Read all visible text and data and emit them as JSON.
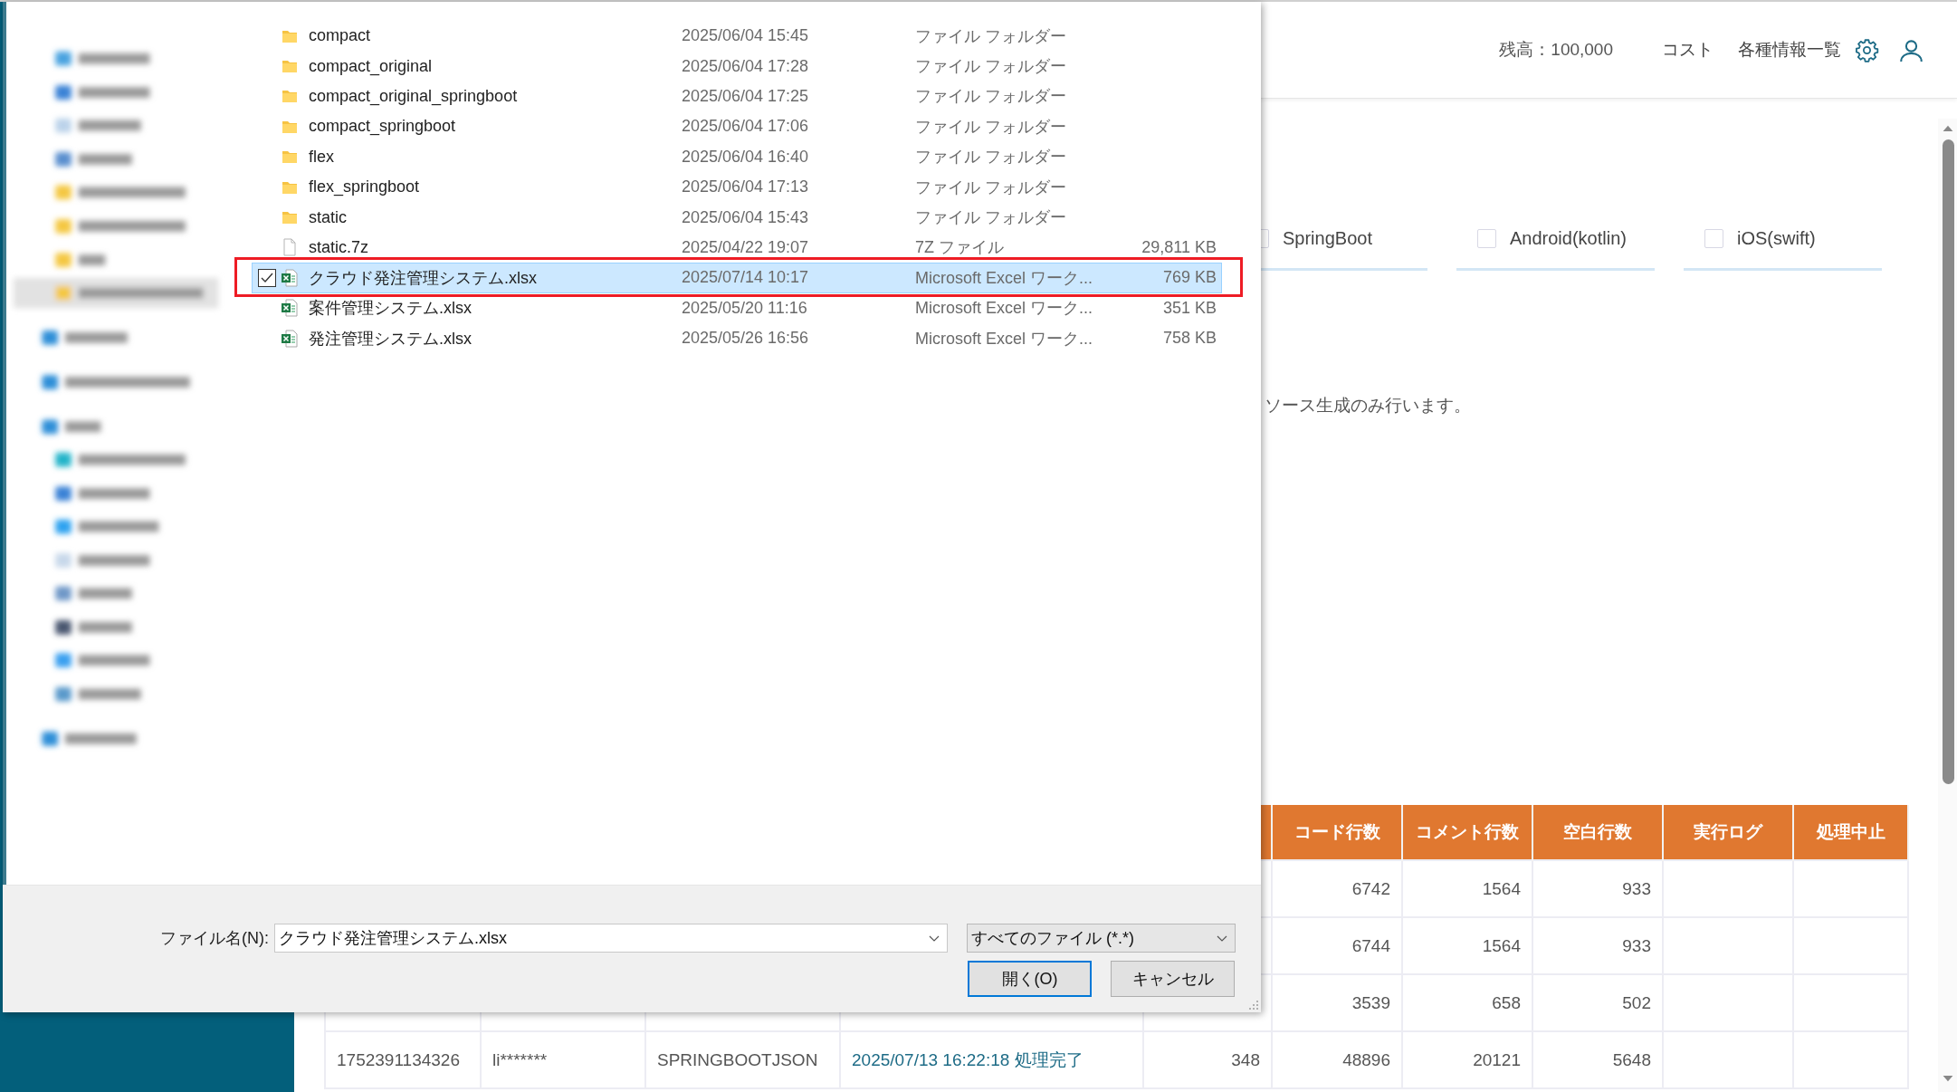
{
  "header": {
    "balance": "残高：100,000",
    "links": [
      "コスト",
      "各種情報一覧"
    ]
  },
  "options": [
    {
      "label": "SpringBoot",
      "checked": false
    },
    {
      "label": "Android(kotlin)",
      "checked": false
    },
    {
      "label": "iOS(swift)",
      "checked": false
    }
  ],
  "note": "ソース生成のみ行います。",
  "table": {
    "columns": [
      "コード行数",
      "コメント行数",
      "空白行数",
      "実行ログ",
      "処理中止"
    ],
    "rows": [
      {
        "cells": [
          "6742",
          "1564",
          "933"
        ]
      },
      {
        "cells": [
          "6744",
          "1564",
          "933"
        ]
      },
      {
        "cells": [
          "3539",
          "658",
          "502"
        ]
      },
      {
        "leading_cells": [
          {
            "kind": "text",
            "text": "1752391134326"
          },
          {
            "kind": "text",
            "text": "li*******"
          },
          {
            "kind": "text",
            "text": "SPRINGBOOTJSON"
          },
          {
            "kind": "link",
            "text": "2025/07/13 16:22:18 処理完了"
          },
          {
            "kind": "number",
            "text": "348"
          }
        ],
        "cells": [
          "48896",
          "20121",
          "5648"
        ]
      }
    ]
  },
  "dialog": {
    "highlight_selected": true,
    "files": [
      {
        "kind": "folder",
        "name": "compact",
        "modified": "2025/06/04 15:45",
        "type": "ファイル フォルダー",
        "selected": false
      },
      {
        "kind": "folder",
        "name": "compact_original",
        "modified": "2025/06/04 17:28",
        "type": "ファイル フォルダー",
        "selected": false
      },
      {
        "kind": "folder",
        "name": "compact_original_springboot",
        "modified": "2025/06/04 17:25",
        "type": "ファイル フォルダー",
        "selected": false
      },
      {
        "kind": "folder",
        "name": "compact_springboot",
        "modified": "2025/06/04 17:06",
        "type": "ファイル フォルダー",
        "selected": false
      },
      {
        "kind": "folder",
        "name": "flex",
        "modified": "2025/06/04 16:40",
        "type": "ファイル フォルダー",
        "selected": false
      },
      {
        "kind": "folder",
        "name": "flex_springboot",
        "modified": "2025/06/04 17:13",
        "type": "ファイル フォルダー",
        "selected": false
      },
      {
        "kind": "folder",
        "name": "static",
        "modified": "2025/06/04 15:43",
        "type": "ファイル フォルダー",
        "selected": false
      },
      {
        "kind": "archive",
        "name": "static.7z",
        "modified": "2025/04/22 19:07",
        "type": "7Z ファイル",
        "size": "29,811 KB",
        "selected": false
      },
      {
        "kind": "excel",
        "name": "クラウド発注管理システム.xlsx",
        "modified": "2025/07/14 10:17",
        "type": "Microsoft Excel ワーク...",
        "size": "769 KB",
        "selected": true
      },
      {
        "kind": "excel",
        "name": "案件管理システム.xlsx",
        "modified": "2025/05/20 11:16",
        "type": "Microsoft Excel ワーク...",
        "size": "351 KB",
        "selected": false
      },
      {
        "kind": "excel",
        "name": "発注管理システム.xlsx",
        "modified": "2025/05/26 16:56",
        "type": "Microsoft Excel ワーク...",
        "size": "758 KB",
        "selected": false
      }
    ],
    "file_name_label": "ファイル名(N):",
    "file_name": "クラウド発注管理システム.xlsx",
    "file_type": "すべてのファイル (*.*)",
    "buttons": [
      {
        "label": "開く(O)",
        "default": true
      },
      {
        "label": "キャンセル",
        "default": false
      }
    ]
  }
}
